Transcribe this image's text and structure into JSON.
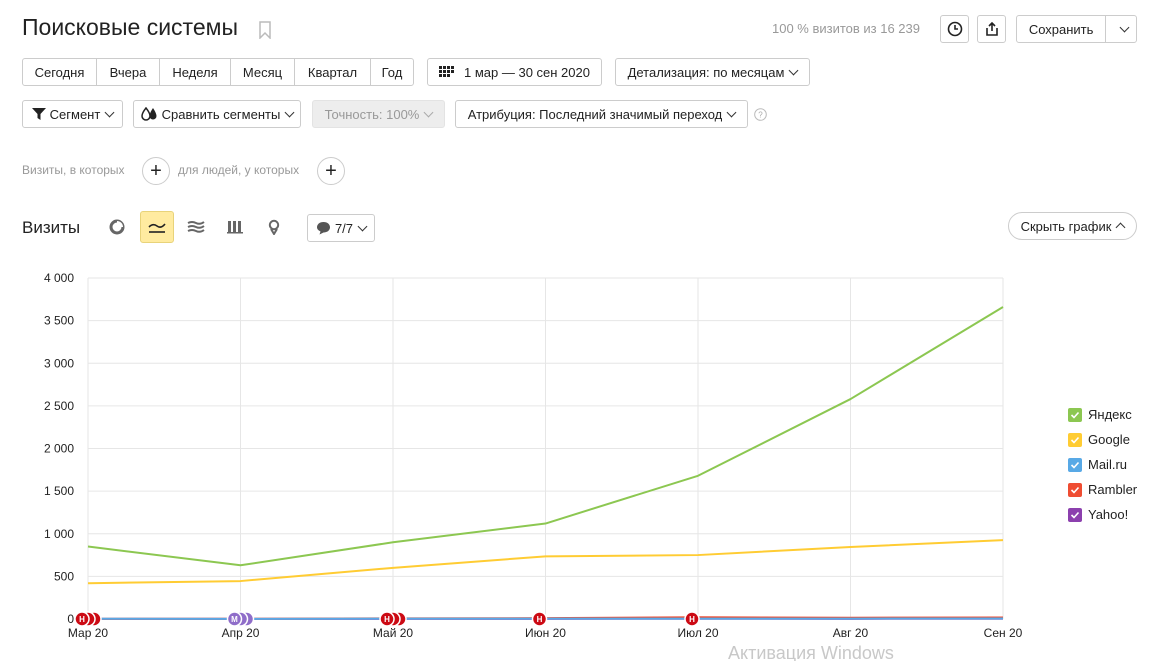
{
  "header": {
    "title": "Поисковые системы",
    "share_text": "100 % визитов из 16 239",
    "save_label": "Сохранить"
  },
  "period": {
    "options": [
      "Сегодня",
      "Вчера",
      "Неделя",
      "Месяц",
      "Квартал",
      "Год"
    ],
    "date_range": "1 мар — 30 сен 2020",
    "detail": "Детализация: по месяцам"
  },
  "filters": {
    "segment": "Сегмент",
    "compare": "Сравнить сегменты",
    "accuracy": "Точность: 100%",
    "attribution": "Атрибуция: Последний значимый переход"
  },
  "conditions": {
    "visits_label": "Визиты, в которых",
    "people_label": "для людей, у которых"
  },
  "chart_section": {
    "title": "Визиты",
    "annotations": "7/7",
    "hide_label": "Скрыть график"
  },
  "colors": {
    "accent": "#ffeba0",
    "marker_red": "#cc0a14",
    "marker_purple": "#8f6dc9"
  },
  "icons": [
    "clock-icon",
    "share-icon",
    "bookmark-icon",
    "calendar-icon",
    "segment-filter-icon",
    "compare-icon",
    "help-icon",
    "plus-icon",
    "pie-chart-icon",
    "line-chart-icon",
    "area-chart-icon",
    "bar-chart-icon",
    "map-icon",
    "comment-icon"
  ],
  "chart_data": {
    "type": "line",
    "categories": [
      "Мар 20",
      "Апр 20",
      "Май 20",
      "Июн 20",
      "Июл 20",
      "Авг 20",
      "Сен 20"
    ],
    "ylim": [
      0,
      4000
    ],
    "yticks": [
      "0",
      "500",
      "1 000",
      "1 500",
      "2 000",
      "2 500",
      "3 000",
      "3 500",
      "4 000"
    ],
    "ytick_values": [
      0,
      500,
      1000,
      1500,
      2000,
      2500,
      3000,
      3500,
      4000
    ],
    "grid": true,
    "legend_position": "right",
    "series": [
      {
        "name": "Яндекс",
        "color": "#8cc751",
        "values": [
          850,
          630,
          900,
          1120,
          1680,
          2580,
          3660
        ]
      },
      {
        "name": "Google",
        "color": "#ffcc33",
        "values": [
          420,
          445,
          600,
          735,
          750,
          845,
          925
        ]
      },
      {
        "name": "Mail.ru",
        "color": "#58a9e6",
        "values": [
          3,
          2,
          4,
          4,
          5,
          5,
          6
        ]
      },
      {
        "name": "Rambler",
        "color": "#ef4d32",
        "values": [
          2,
          3,
          8,
          10,
          20,
          15,
          18
        ]
      },
      {
        "name": "Yahoo!",
        "color": "#8c40ae",
        "values": [
          1,
          1,
          2,
          2,
          3,
          2,
          3
        ]
      }
    ],
    "markers": [
      {
        "category": "Мар 20",
        "label": "Н",
        "color": "red"
      },
      {
        "category": "Апр 20",
        "label": "М",
        "color": "purple"
      },
      {
        "category": "Май 20",
        "label": "Н",
        "color": "red"
      },
      {
        "category": "Июн 20",
        "label": "Н",
        "color": "red"
      },
      {
        "category": "Июл 20",
        "label": "Н",
        "color": "red"
      }
    ]
  },
  "watermark": "Активация Windows"
}
